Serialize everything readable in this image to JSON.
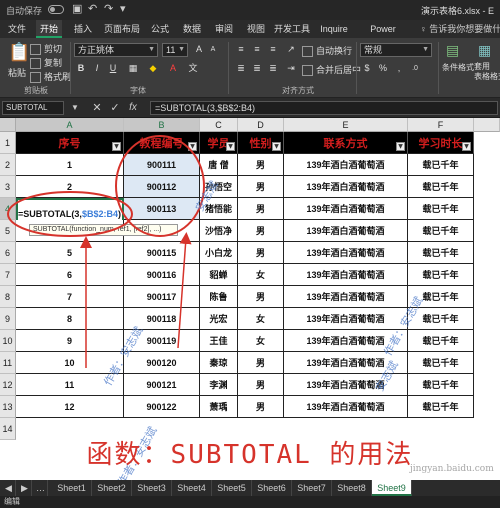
{
  "window": {
    "autosave_label": "自动保存",
    "filename": "演示表格6.xlsx - E"
  },
  "ribbon_tabs": [
    "文件",
    "开始",
    "插入",
    "页面布局",
    "公式",
    "数据",
    "审阅",
    "视图",
    "开发工具",
    "Inquire",
    "Power Pivot"
  ],
  "tell_me": "告诉我你想要做什么",
  "ribbon": {
    "paste": "粘贴",
    "cut": "剪切",
    "copy": "复制",
    "format_painter": "格式刷",
    "clipboard_group": "剪贴板",
    "font_name": "方正姚体",
    "font_size": "11",
    "font_group": "字体",
    "wrap_text": "自动换行",
    "merge_center": "合并后居中",
    "align_group": "对齐方式",
    "number_format": "常规",
    "cond_format": "条件格式",
    "table_format": "套用\n表格格式"
  },
  "formula_bar": {
    "name_box": "SUBTOTAL",
    "formula": "=SUBTOTAL(3,$B$2:B4)",
    "cancel": "✕",
    "enter": "✓",
    "fx": "fx"
  },
  "columns": [
    "A",
    "B",
    "C",
    "D",
    "E",
    "F"
  ],
  "rows": [
    "1",
    "2",
    "3",
    "4",
    "5",
    "6",
    "7",
    "8",
    "9",
    "10",
    "11",
    "12",
    "13",
    "14"
  ],
  "table": {
    "headers": [
      "序号",
      "教程编号",
      "学员",
      "性别",
      "联系方式",
      "学习时长"
    ],
    "rows": [
      [
        "1",
        "900111",
        "唐 僧",
        "男",
        "139年酒白酒葡萄酒",
        "载已千年"
      ],
      [
        "2",
        "900112",
        "孙悟空",
        "男",
        "139年酒白酒葡萄酒",
        "载已千年"
      ],
      [
        "",
        "900113",
        "猪悟能",
        "男",
        "139年酒白酒葡萄酒",
        "载已千年"
      ],
      [
        "4",
        "900114",
        "沙悟净",
        "男",
        "139年酒白酒葡萄酒",
        "载已千年"
      ],
      [
        "5",
        "900115",
        "小白龙",
        "男",
        "139年酒白酒葡萄酒",
        "载已千年"
      ],
      [
        "6",
        "900116",
        "貂蝉",
        "女",
        "139年酒白酒葡萄酒",
        "载已千年"
      ],
      [
        "7",
        "900117",
        "陈鲁",
        "男",
        "139年酒白酒葡萄酒",
        "载已千年"
      ],
      [
        "8",
        "900118",
        "光宏",
        "女",
        "139年酒白酒葡萄酒",
        "载已千年"
      ],
      [
        "9",
        "900119",
        "王佳",
        "女",
        "139年酒白酒葡萄酒",
        "载已千年"
      ],
      [
        "10",
        "900120",
        "秦琼",
        "男",
        "139年酒白酒葡萄酒",
        "载已千年"
      ],
      [
        "11",
        "900121",
        "李渊",
        "男",
        "139年酒白酒葡萄酒",
        "载已千年"
      ],
      [
        "12",
        "900122",
        "萧瑀",
        "男",
        "139年酒白酒葡萄酒",
        "载已千年"
      ]
    ]
  },
  "in_cell_edit": {
    "prefix": "=SUBTOTAL(3,",
    "ref": "$B$2:B4",
    "suffix": ")"
  },
  "tooltip": "SUBTOTAL(function_num, ref1, [ref2], ...)",
  "caption": "函数：SUBTOTAL 的用法",
  "watermarks": [
    "作者：安志斌",
    "安志斌",
    "作者：安志斌",
    "安志斌",
    "作者：安志斌",
    "jingyan.baidu.com"
  ],
  "sheets": [
    "Sheet1",
    "Sheet2",
    "Sheet3",
    "Sheet4",
    "Sheet5",
    "Sheet6",
    "Sheet7",
    "Sheet8",
    "Sheet9"
  ],
  "active_sheet": "Sheet9",
  "status": "编辑",
  "colors": {
    "accent": "#217346",
    "header_text": "#d21e1e",
    "annotation": "#d6332b"
  }
}
